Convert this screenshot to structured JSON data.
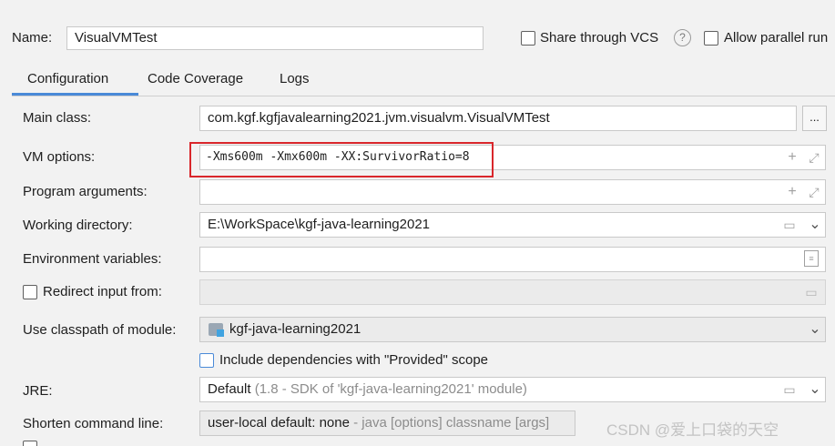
{
  "header": {
    "name_label": "Name:",
    "name_value": "VisualVMTest",
    "share_vcs_label": "Share through VCS",
    "help_icon": "question-icon",
    "allow_parallel_label": "Allow parallel run"
  },
  "tabs": [
    {
      "label": "Configuration",
      "active": true
    },
    {
      "label": "Code Coverage",
      "active": false
    },
    {
      "label": "Logs",
      "active": false
    }
  ],
  "form": {
    "main_class_label": "Main class:",
    "main_class_value": "com.kgf.kgfjavalearning2021.jvm.visualvm.VisualVMTest",
    "main_class_button": "...",
    "vm_options_label": "VM options:",
    "vm_options_value": "-Xms600m -Xmx600m -XX:SurvivorRatio=8",
    "program_arguments_label": "Program arguments:",
    "program_arguments_value": "",
    "working_directory_label": "Working directory:",
    "working_directory_value": "E:\\WorkSpace\\kgf-java-learning2021",
    "environment_variables_label": "Environment variables:",
    "environment_variables_value": "",
    "redirect_input_label": "Redirect input from:",
    "classpath_module_label": "Use classpath of module:",
    "classpath_module_value": "kgf-java-learning2021",
    "include_dependencies_label": "Include dependencies with \"Provided\" scope",
    "jre_label": "JRE:",
    "jre_value": "Default",
    "jre_detail": "(1.8 - SDK of 'kgf-java-learning2021' module)",
    "shorten_label": "Shorten command line:",
    "shorten_value": "user-local default: none",
    "shorten_detail": "- java [options] classname [args]"
  },
  "watermark": "CSDN @爱上口袋的天空",
  "colors": {
    "highlight_box": "#d9262b",
    "tab_underline": "#4a8ad8",
    "panel_bg": "#f2f2f2"
  }
}
